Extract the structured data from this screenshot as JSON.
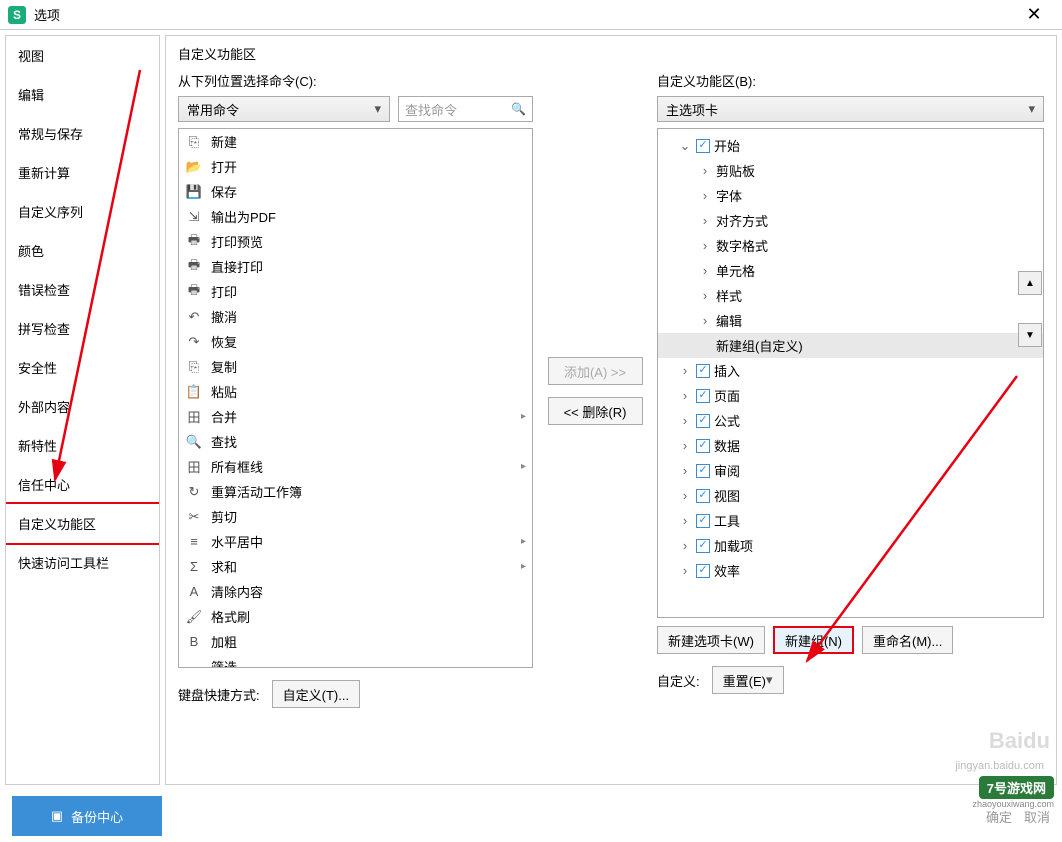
{
  "titlebar": {
    "logo": "S",
    "title": "选项"
  },
  "sidebar": {
    "items": [
      "视图",
      "编辑",
      "常规与保存",
      "重新计算",
      "自定义序列",
      "颜色",
      "错误检查",
      "拼写检查",
      "安全性",
      "外部内容",
      "新特性",
      "信任中心",
      "自定义功能区",
      "快速访问工具栏"
    ],
    "highlighted_index": 12
  },
  "section_title": "自定义功能区",
  "left": {
    "label": "从下列位置选择命令(C):",
    "dropdown": "常用命令",
    "search_placeholder": "查找命令",
    "commands": [
      {
        "icon": "⎘",
        "label": "新建"
      },
      {
        "icon": "📂",
        "label": "打开"
      },
      {
        "icon": "💾",
        "label": "保存"
      },
      {
        "icon": "⇲",
        "label": "输出为PDF"
      },
      {
        "icon": "🖶",
        "label": "打印预览"
      },
      {
        "icon": "🖶",
        "label": "直接打印"
      },
      {
        "icon": "🖶",
        "label": "打印"
      },
      {
        "icon": "↶",
        "label": "撤消"
      },
      {
        "icon": "↷",
        "label": "恢复"
      },
      {
        "icon": "⎘",
        "label": "复制"
      },
      {
        "icon": "📋",
        "label": "粘贴"
      },
      {
        "icon": "田",
        "label": "合并",
        "caret": true
      },
      {
        "icon": "🔍",
        "label": "查找"
      },
      {
        "icon": "田",
        "label": "所有框线",
        "caret": true
      },
      {
        "icon": "↻",
        "label": "重算活动工作簿"
      },
      {
        "icon": "✂",
        "label": "剪切"
      },
      {
        "icon": "≡",
        "label": "水平居中",
        "caret": true
      },
      {
        "icon": "Σ",
        "label": "求和",
        "caret": true
      },
      {
        "icon": "A",
        "label": "清除内容"
      },
      {
        "icon": "🖌",
        "label": "格式刷"
      },
      {
        "icon": "B",
        "label": "加粗"
      },
      {
        "icon": "",
        "label": "筛选"
      }
    ],
    "kb_label": "键盘快捷方式:",
    "kb_button": "自定义(T)..."
  },
  "middle": {
    "add": "添加(A) >>",
    "remove": "<< 删除(R)"
  },
  "right": {
    "label": "自定义功能区(B):",
    "dropdown": "主选项卡",
    "tree": [
      {
        "indent": 1,
        "exp": "⌄",
        "chk": true,
        "label": "开始"
      },
      {
        "indent": 2,
        "exp": "›",
        "label": "剪贴板"
      },
      {
        "indent": 2,
        "exp": "›",
        "label": "字体"
      },
      {
        "indent": 2,
        "exp": "›",
        "label": "对齐方式"
      },
      {
        "indent": 2,
        "exp": "›",
        "label": "数字格式"
      },
      {
        "indent": 2,
        "exp": "›",
        "label": "单元格"
      },
      {
        "indent": 2,
        "exp": "›",
        "label": "样式"
      },
      {
        "indent": 2,
        "exp": "›",
        "label": "编辑"
      },
      {
        "indent": 2,
        "exp": "",
        "label": "新建组(自定义)",
        "selected": true
      },
      {
        "indent": 1,
        "exp": "›",
        "chk": true,
        "label": "插入"
      },
      {
        "indent": 1,
        "exp": "›",
        "chk": true,
        "label": "页面"
      },
      {
        "indent": 1,
        "exp": "›",
        "chk": true,
        "label": "公式"
      },
      {
        "indent": 1,
        "exp": "›",
        "chk": true,
        "label": "数据"
      },
      {
        "indent": 1,
        "exp": "›",
        "chk": true,
        "label": "审阅"
      },
      {
        "indent": 1,
        "exp": "›",
        "chk": true,
        "label": "视图"
      },
      {
        "indent": 1,
        "exp": "›",
        "chk": true,
        "label": "工具"
      },
      {
        "indent": 1,
        "exp": "›",
        "chk": true,
        "label": "加载项"
      },
      {
        "indent": 1,
        "exp": "›",
        "chk": true,
        "label": "效率"
      }
    ],
    "new_tab": "新建选项卡(W)",
    "new_group": "新建组(N)",
    "rename": "重命名(M)...",
    "custom_label": "自定义:",
    "reset": "重置(E)"
  },
  "bottom": {
    "backup": "备份中心",
    "ok": "确定",
    "cancel": "取消"
  },
  "watermark": "Baidu",
  "watermark2": "jingyan.baidu.com",
  "game_badge": "7号游戏网",
  "game_badge_sub": "zhaoyouxiwang.com"
}
